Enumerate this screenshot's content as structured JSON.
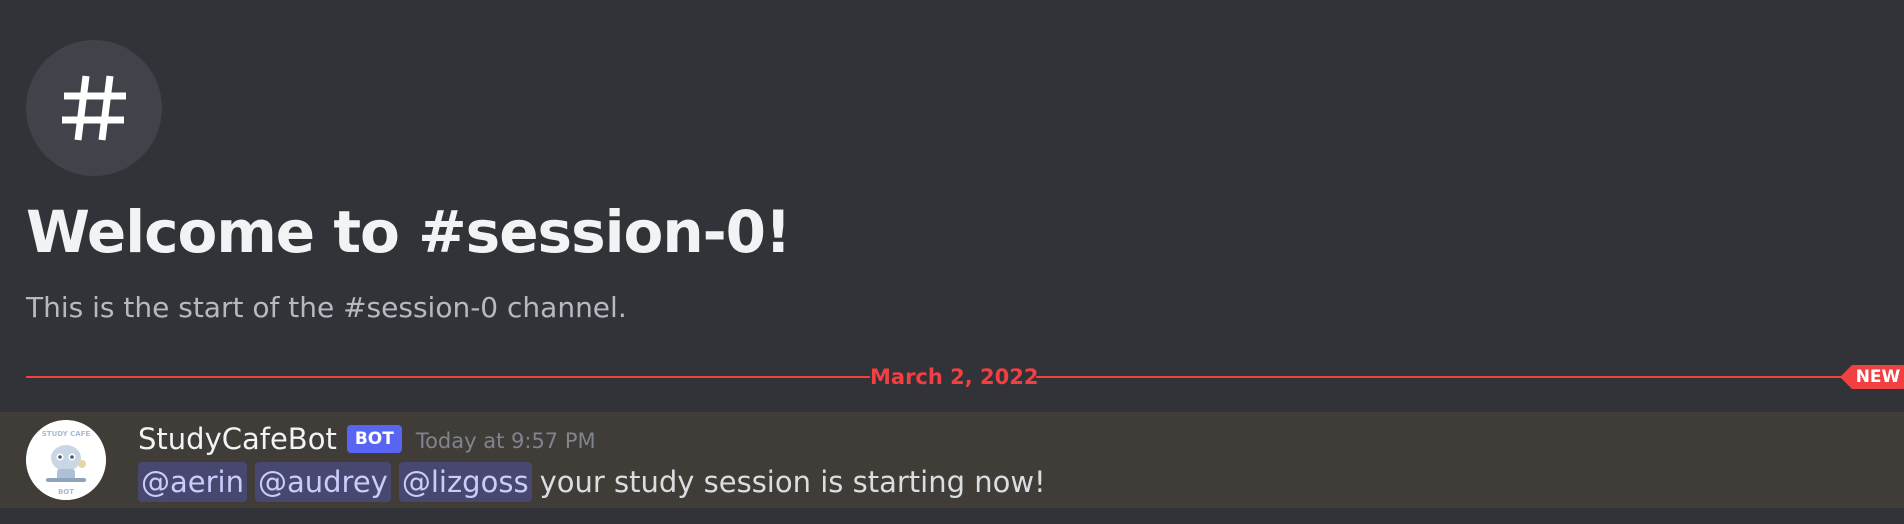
{
  "channel": {
    "hash_icon": "hash-icon",
    "welcome_title": "Welcome to #session-0!",
    "welcome_subtitle": "This is the start of the #session-0 channel."
  },
  "divider": {
    "date": "March 2, 2022",
    "new_badge": "NEW",
    "color": "#f23f42"
  },
  "message": {
    "avatar_icon": "study-cafe-bot-avatar",
    "avatar_text_top": "STUDY CAFE",
    "avatar_text_bottom": "BOT",
    "author": "StudyCafeBot",
    "bot_tag": "BOT",
    "timestamp": "Today at 9:57 PM",
    "mentions": [
      "@aerin",
      "@audrey",
      "@lizgoss"
    ],
    "text": "your study session is starting now!",
    "highlight_color": "#403c37"
  },
  "colors": {
    "background": "#313338",
    "accent": "#5865f2"
  }
}
